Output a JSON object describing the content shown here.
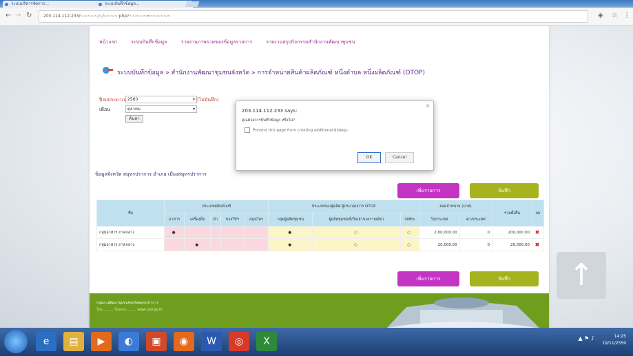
{
  "browser": {
    "tabs": [
      "ระบบบริหารจัดการ...",
      "ระบบบันทึกข้อมูล..."
    ],
    "url": "203.114.112.233/~~~~~/~/~~~~.php?~~~~~=~~~~~~",
    "back_icon": "arrow-left-icon",
    "forward_icon": "arrow-right-icon",
    "reload_icon": "reload-icon"
  },
  "menu": [
    "หน้าแรก",
    "ระบบบันทึกข้อมูล",
    "รายงานภาพรวมของข้อมูลรายการ",
    "รายงานสรุปกิจกรรมสำนักงานพัฒนาชุมชน"
  ],
  "page_title": "ระบบบันทึกข้อมูล » สำนักงานพัฒนาชุมชนจังหวัด » การจำหน่ายสินค้าผลิตภัณฑ์ หนึ่งตำบล หนึ่งผลิตภัณฑ์ (OTOP)",
  "filter": {
    "year_label": "ปีงบประมาณ",
    "year_value": "2560",
    "month_label": "เดือน",
    "month_value": "ตุลาคม",
    "search_button": "ค้นหา",
    "note": "(ไม่บันทึก)"
  },
  "dialog": {
    "host": "203.114.112.233 says:",
    "message": "คุณต้องการบันทึกข้อมูล หรือไม่?",
    "checkbox": "Prevent this page from creating additional dialogs.",
    "ok": "OK",
    "cancel": "Cancel"
  },
  "section_title": "ข้อมูลจังหวัด สมุทรปราการ อำเภอ เมืองสมุทรปราการ",
  "buttons": {
    "add": "เพิ่มรายการ",
    "save": "บันทึก"
  },
  "table": {
    "h_group1": "ประเภทผลิตภัณฑ์",
    "h_group2": "ประเภทของผู้ผลิต ผู้ประกอบการ OTOP",
    "h_group3": "ยอดจำหน่าย (บาท)",
    "h_no": "ชื่อ",
    "h_total": "รวมทั้งสิ้น",
    "h_del": "ลบ",
    "sub": [
      "อาหาร",
      "เครื่องดื่ม",
      "ผ้า",
      "ของใช้ฯ",
      "สมุนไพร",
      "กลุ่มผู้ผลิตชุมชน",
      "ผู้ผลิตชุมชนที่เป็นเจ้าของรายเดียว",
      "SMEs",
      "ในประเทศ",
      "ต่างประเทศ"
    ],
    "rows": [
      {
        "name": "กลุ่มอาหาร ภาคกลาง",
        "domestic": "2,00,000.00",
        "foreign": "0",
        "total": "200,000.00"
      },
      {
        "name": "กลุ่มอาหาร ภาคกลาง",
        "domestic": "20,000.00",
        "foreign": "0",
        "total": "20,000.00"
      }
    ]
  },
  "footer": {
    "line1": "กลุ่มงานพัฒนาชุมชนจังหวัดสมุทรปราการ",
    "line2": "โทร. ........ โทรสาร ........ www.cdd.go.th"
  },
  "clock": {
    "time": "14:25",
    "date": "19/11/2559"
  },
  "colors": {
    "purple": "#c334c4",
    "olive": "#a6b31e",
    "footer": "#6f9e1e",
    "header_blue": "#bfe0ef"
  }
}
